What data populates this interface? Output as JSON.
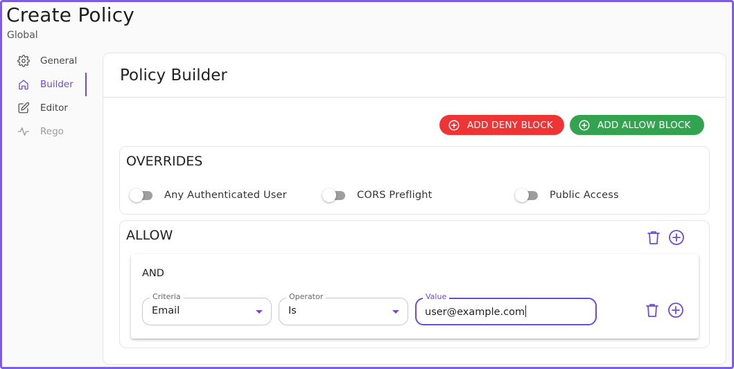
{
  "page": {
    "title": "Create Policy",
    "subtitle": "Global"
  },
  "sidebar": {
    "items": [
      {
        "label": "General",
        "icon": "gear-icon"
      },
      {
        "label": "Builder",
        "icon": "home-icon",
        "active": true
      },
      {
        "label": "Editor",
        "icon": "edit-icon"
      },
      {
        "label": "Rego",
        "icon": "activity-icon",
        "disabled": true
      }
    ]
  },
  "builder": {
    "title": "Policy Builder",
    "add_deny_label": "ADD DENY BLOCK",
    "add_allow_label": "ADD ALLOW BLOCK"
  },
  "overrides": {
    "title": "OVERRIDES",
    "toggles": [
      {
        "label": "Any Authenticated User",
        "checked": false
      },
      {
        "label": "CORS Preflight",
        "checked": false
      },
      {
        "label": "Public Access",
        "checked": false
      }
    ]
  },
  "allow_block": {
    "title": "ALLOW",
    "and_group": {
      "title": "AND",
      "criteria": {
        "label": "Criteria",
        "value": "Email"
      },
      "operator": {
        "label": "Operator",
        "value": "Is"
      },
      "value": {
        "label": "Value",
        "value": "user@example.com"
      }
    }
  },
  "colors": {
    "accent": "#6e4ad9",
    "deny": "#ee3434",
    "allow": "#34a350",
    "frame": "#7c5ce0"
  }
}
